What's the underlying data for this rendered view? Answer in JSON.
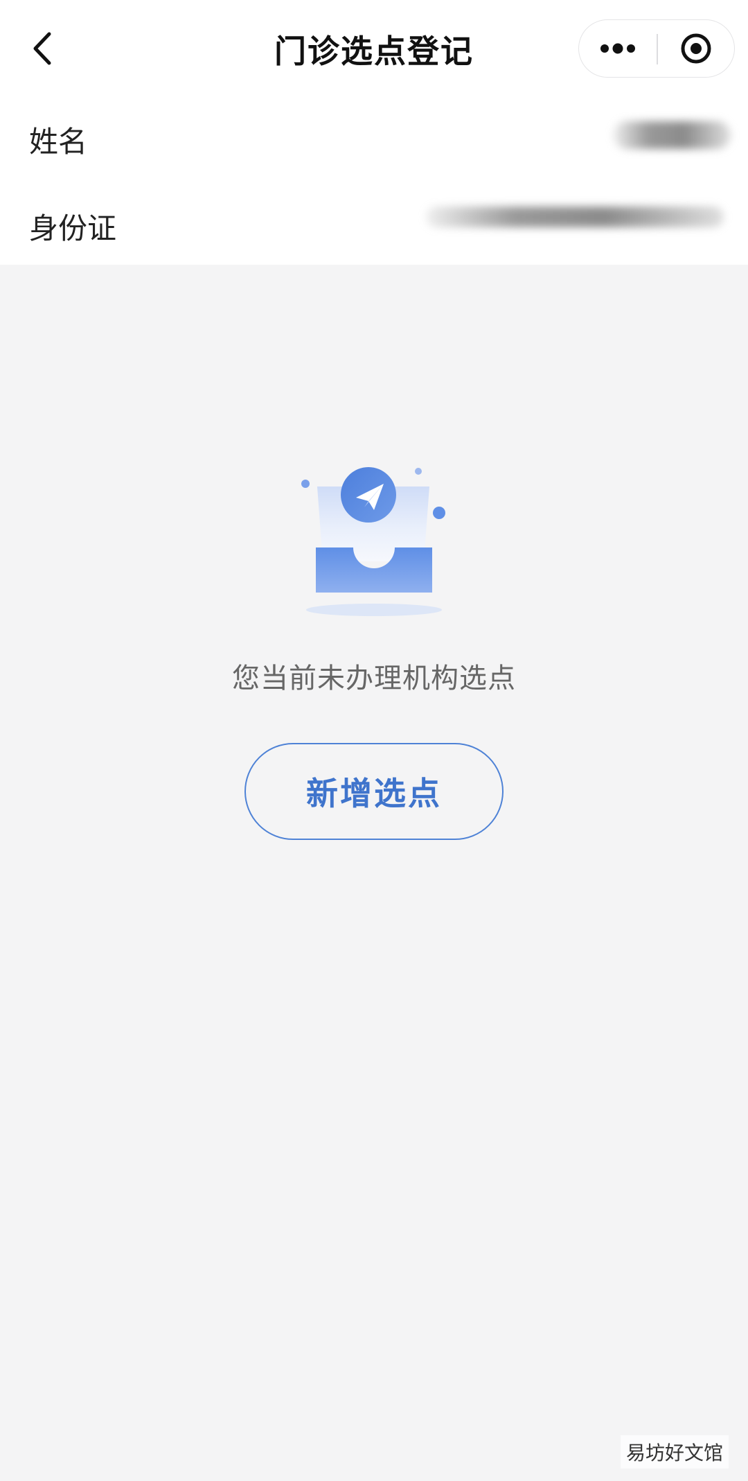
{
  "nav": {
    "title": "门诊选点登记",
    "back_icon": "chevron-left-icon",
    "more_icon": "more-dots-icon",
    "close_icon": "target-close-icon"
  },
  "info": {
    "name_label": "姓名",
    "id_label": "身份证"
  },
  "empty_state": {
    "illustration_icon": "empty-inbox-paper-plane-icon",
    "message": "您当前未办理机构选点",
    "accent_color": "#4e82d6"
  },
  "actions": {
    "add_label": "新增选点"
  },
  "watermark": "易坊好文馆"
}
